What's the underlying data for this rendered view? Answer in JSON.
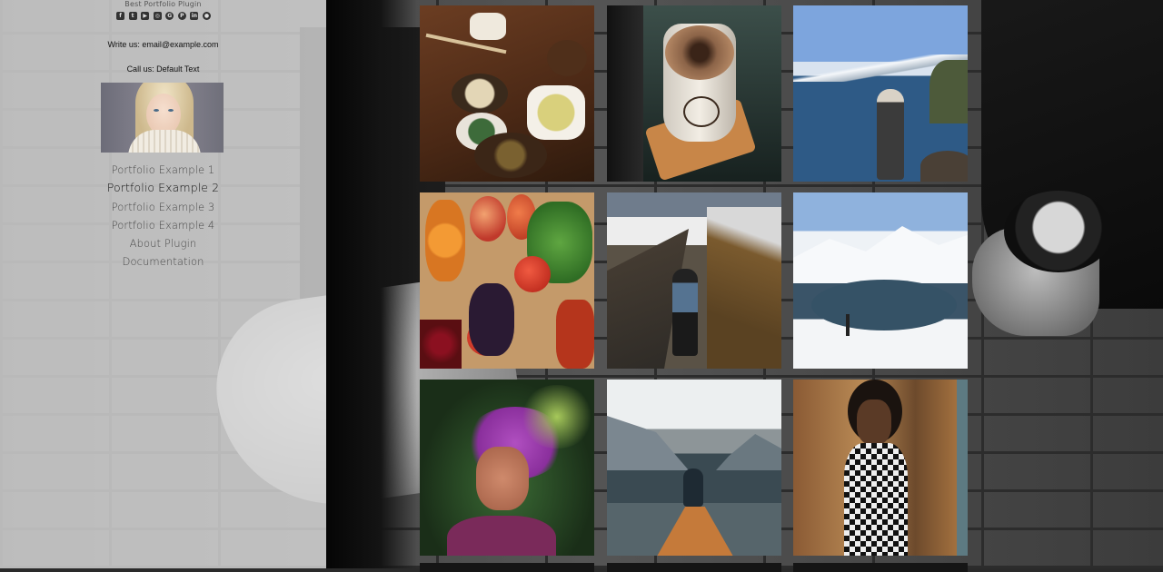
{
  "sidebar": {
    "plugin_name": "Best Portfolio Plugin",
    "socials": [
      {
        "icon": "facebook-icon",
        "glyph": "f"
      },
      {
        "icon": "twitter-icon",
        "glyph": "t"
      },
      {
        "icon": "youtube-icon",
        "glyph": "▶"
      },
      {
        "icon": "instagram-icon",
        "glyph": "◎"
      },
      {
        "icon": "google-plus-icon",
        "glyph": "G"
      },
      {
        "icon": "pinterest-icon",
        "glyph": "P"
      },
      {
        "icon": "linkedin-icon",
        "glyph": "in"
      },
      {
        "icon": "github-icon",
        "glyph": "●"
      }
    ],
    "write_us": "Write us: email@example.com",
    "call_us": "Call us: Default Text",
    "nav": [
      {
        "label": "Portfolio Example 1",
        "active": false
      },
      {
        "label": "Portfolio Example 2",
        "active": true
      },
      {
        "label": "Portfolio Example 3",
        "active": false
      },
      {
        "label": "Portfolio Example 4",
        "active": false
      },
      {
        "label": "About Plugin",
        "active": false
      },
      {
        "label": "Documentation",
        "active": false
      }
    ]
  },
  "gallery": {
    "items": [
      {
        "subject": "food-bowls-photo"
      },
      {
        "subject": "coffee-cup-photo"
      },
      {
        "subject": "mountain-lake-photo"
      },
      {
        "subject": "vegetables-photo"
      },
      {
        "subject": "mountain-hiker-photo"
      },
      {
        "subject": "snowy-fjord-photo"
      },
      {
        "subject": "color-powder-man-photo"
      },
      {
        "subject": "pier-lake-photo"
      },
      {
        "subject": "woman-checkered-dress-photo"
      }
    ]
  },
  "colors": {
    "sidebar_bg": "#e1e1e1",
    "text_dark": "#111111",
    "nav_text": "#4a4a4a"
  }
}
